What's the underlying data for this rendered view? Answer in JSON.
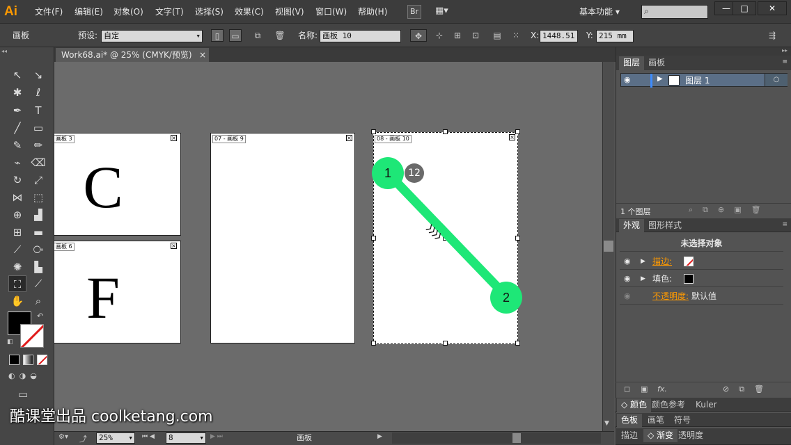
{
  "app": {
    "logo": "Ai"
  },
  "menu": [
    "文件(F)",
    "编辑(E)",
    "对象(O)",
    "文字(T)",
    "选择(S)",
    "效果(C)",
    "视图(V)",
    "窗口(W)",
    "帮助(H)"
  ],
  "menubar_right": {
    "bridge": "Br",
    "workspace": "基本功能",
    "window_buttons": [
      "—",
      "□",
      "✕"
    ]
  },
  "controlbar": {
    "tool_name": "画板",
    "preset_label": "预设:",
    "preset_value": "自定",
    "name_label": "名称:",
    "name_value": "画板 10",
    "x_label": "X:",
    "x_value": "1448.51 r",
    "y_label": "Y:",
    "y_value": "215 mm"
  },
  "document": {
    "tab_title": "Work68.ai* @ 25% (CMYK/预览)",
    "close": "×"
  },
  "artboards": [
    {
      "label": "画板 3",
      "letter": "C"
    },
    {
      "label": "画板 6",
      "letter": "F"
    },
    {
      "label": "07 - 画板 9",
      "letter": ""
    },
    {
      "label": "08 - 画板 10",
      "letter": ""
    }
  ],
  "annotations": {
    "marker_1": "1",
    "marker_2": "2",
    "step_badge": "12",
    "arrows": "〉〉〉〉"
  },
  "status": {
    "zoom": "25%",
    "page": "8",
    "mode": "画板"
  },
  "layers_panel": {
    "tabs": [
      "图层",
      "画板"
    ],
    "layer_name": "图层 1",
    "footer_count": "1 个图层"
  },
  "appearance_panel": {
    "tabs": [
      "外观",
      "图形样式"
    ],
    "header": "未选择对象",
    "stroke_label": "描边:",
    "fill_label": "填色:",
    "opacity_label": "不透明度:",
    "opacity_value": "默认值",
    "fx_label": "fx."
  },
  "bottom_panels": {
    "row1": [
      "颜色",
      "颜色参考",
      "Kuler"
    ],
    "row2": [
      "色板",
      "画笔",
      "符号"
    ],
    "row3": [
      "描边",
      "渐变",
      "透明度"
    ]
  },
  "watermark": "酷课堂出品 coolketang.com",
  "colors": {
    "accent_orange": "#ff9a00",
    "marker_green": "#1ee777",
    "badge_gray": "#6a6a6a",
    "selected_layer": "#5b6f87"
  }
}
